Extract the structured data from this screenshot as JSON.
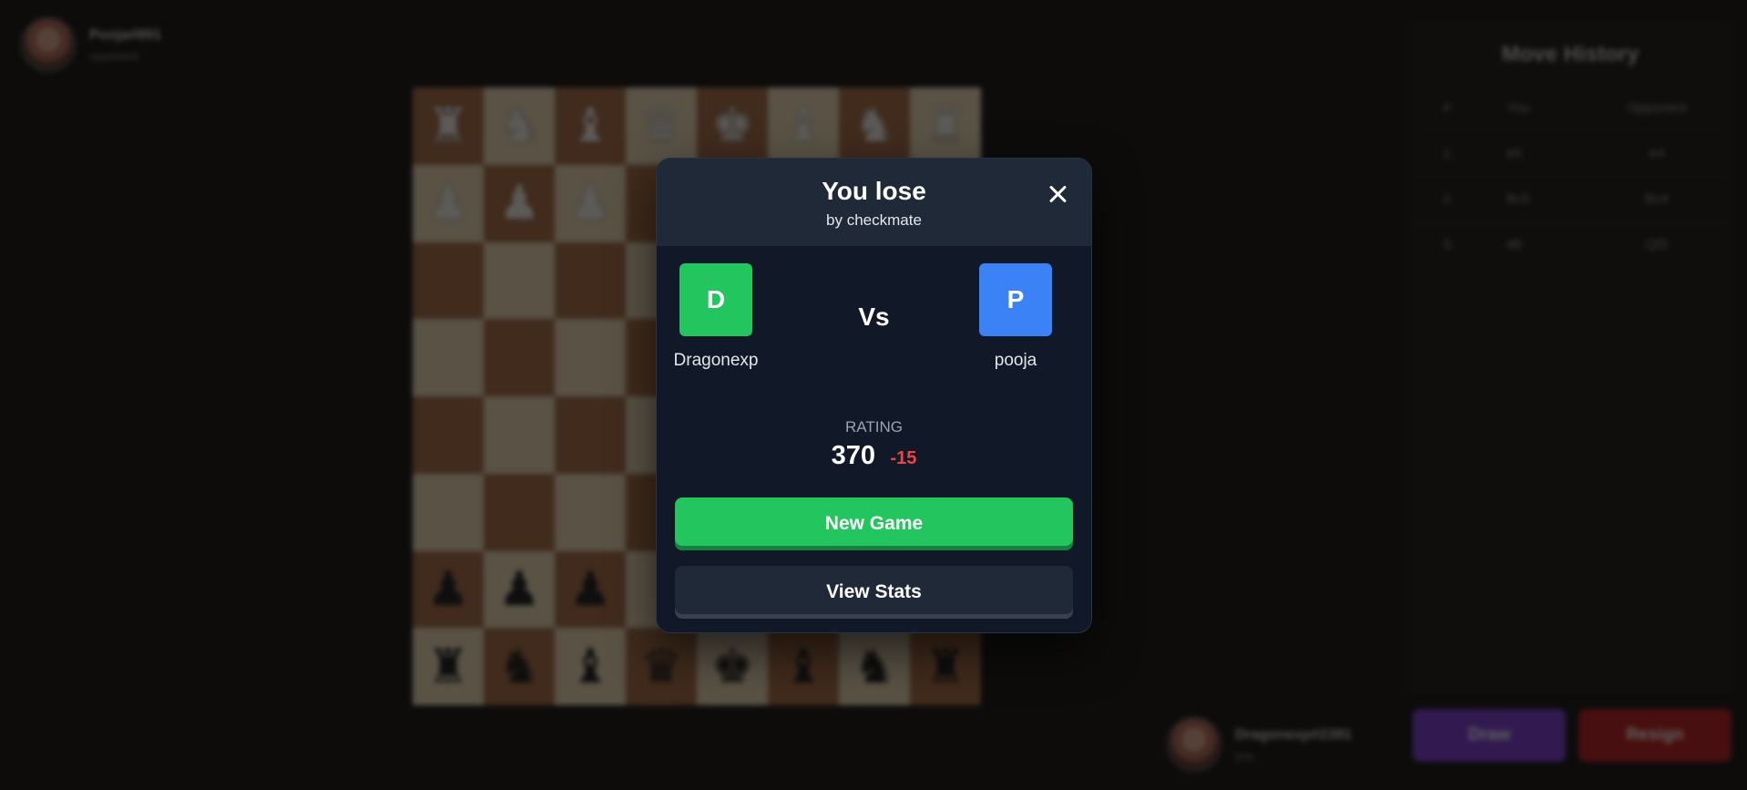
{
  "background": {
    "top_player": {
      "name": "Pooja#891",
      "sub": "opponent"
    },
    "bottom_player": {
      "name": "Dragonexp#2391",
      "sub": "you"
    },
    "board": [
      [
        "♜",
        "♞",
        "♝",
        "♛",
        "♚",
        "♝",
        "♞",
        "♜"
      ],
      [
        "♟",
        "♟",
        "♟",
        "",
        "",
        "",
        "",
        ""
      ],
      [
        "",
        "",
        "",
        "",
        "",
        "",
        "",
        ""
      ],
      [
        "",
        "",
        "",
        "",
        "",
        "",
        "",
        ""
      ],
      [
        "",
        "",
        "",
        "",
        "",
        "",
        "",
        ""
      ],
      [
        "",
        "",
        "",
        "",
        "",
        "",
        "",
        ""
      ],
      [
        "♟",
        "♟",
        "♟",
        "",
        "",
        "",
        "",
        ""
      ],
      [
        "♜",
        "♞",
        "♝",
        "♛",
        "♚",
        "♝",
        "♞",
        "♜"
      ]
    ],
    "move_history": {
      "title": "Move History",
      "headers": [
        "#",
        "You",
        "Opponent"
      ],
      "rows": [
        [
          "1.",
          "e5",
          "e4"
        ],
        [
          "2.",
          "Bc5",
          "Bc4"
        ],
        [
          "3.",
          "d6",
          "Qf3"
        ]
      ]
    },
    "draw_label": "Draw",
    "resign_label": "Resign"
  },
  "modal": {
    "title": "You lose",
    "subtitle": "by checkmate",
    "left_player": {
      "initial": "D",
      "name": "Dragonexp",
      "color": "#22c55e"
    },
    "vs_label": "Vs",
    "right_player": {
      "initial": "P",
      "name": "pooja",
      "color": "#3b82f6"
    },
    "rating_label": "RATING",
    "rating_value": "370",
    "rating_change": "-15",
    "new_game_label": "New Game",
    "view_stats_label": "View Stats"
  }
}
